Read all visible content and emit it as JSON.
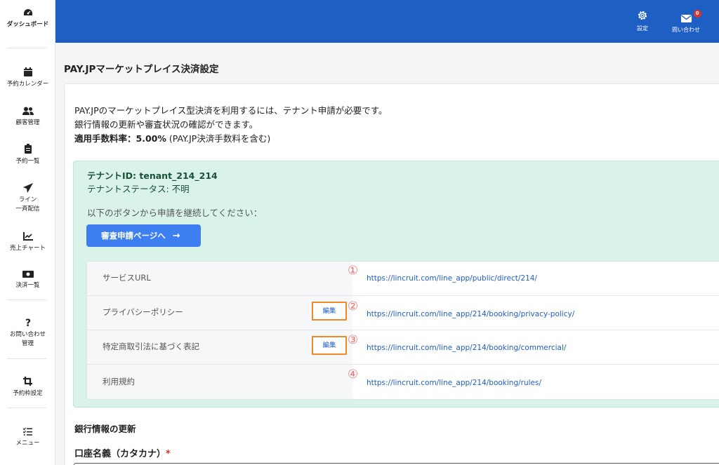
{
  "sidebar": {
    "dashboard": "ダッシュボード",
    "items": [
      {
        "label": "予約カレンダー",
        "icon": "calendar-icon"
      },
      {
        "label": "顧客管理",
        "icon": "users-icon"
      },
      {
        "label": "予約一覧",
        "icon": "clipboard-icon"
      },
      {
        "label_line1": "ライン",
        "label_line2": "一斉配信",
        "icon": "paper-plane-icon"
      },
      {
        "label": "売上チャート",
        "icon": "chart-line-icon"
      },
      {
        "label": "決済一覧",
        "icon": "money-bill-icon"
      },
      {
        "label_line1": "お問い合わせ",
        "label_line2": "管理",
        "icon": "question-icon"
      },
      {
        "label": "予約枠設定",
        "icon": "crop-icon"
      },
      {
        "label": "メニュー",
        "icon": "list-check-icon"
      }
    ]
  },
  "header": {
    "settings_label": "設定",
    "inquiry_label": "問い合わせ",
    "inquiry_badge": "0",
    "colors": {
      "bar": "#1d5fc2",
      "badge": "#e0312b"
    }
  },
  "main": {
    "page_title": "PAY.JPマーケットプレイス決済設定",
    "intro_line1": "PAY.JPのマーケットプレイス型決済を利用するには、テナント申請が必要です。",
    "intro_line2": "銀行情報の更新や審査状況の確認ができます。",
    "fee_label": "適用手数料率：5.00%",
    "fee_note": " (PAY.JP決済手数料を含む)",
    "tenant": {
      "id_text": "テナントID: tenant_214_214",
      "status_text": "テナントステータス: 不明",
      "continue_text": "以下のボタンから申請を継続してください：",
      "review_button": "審査申請ページへ",
      "review_arrow": "→"
    },
    "urls": [
      {
        "label": "サービスURL",
        "num": "①",
        "url": "https://lincruit.com/line_app/public/direct/214/",
        "edit": ""
      },
      {
        "label": "プライバシーポリシー",
        "num": "②",
        "url": "https://lincruit.com/line_app/214/booking/privacy-policy/",
        "edit": "編集"
      },
      {
        "label": "特定商取引法に基づく表記",
        "num": "③",
        "url": "https://lincruit.com/line_app/214/booking/commercial/",
        "edit": "編集"
      },
      {
        "label": "利用規約",
        "num": "④",
        "url": "https://lincruit.com/line_app/214/booking/rules/",
        "edit": ""
      }
    ],
    "bank_title": "銀行情報の更新",
    "account_name_label": "口座名義（カタカナ）",
    "required_mark": "*"
  }
}
